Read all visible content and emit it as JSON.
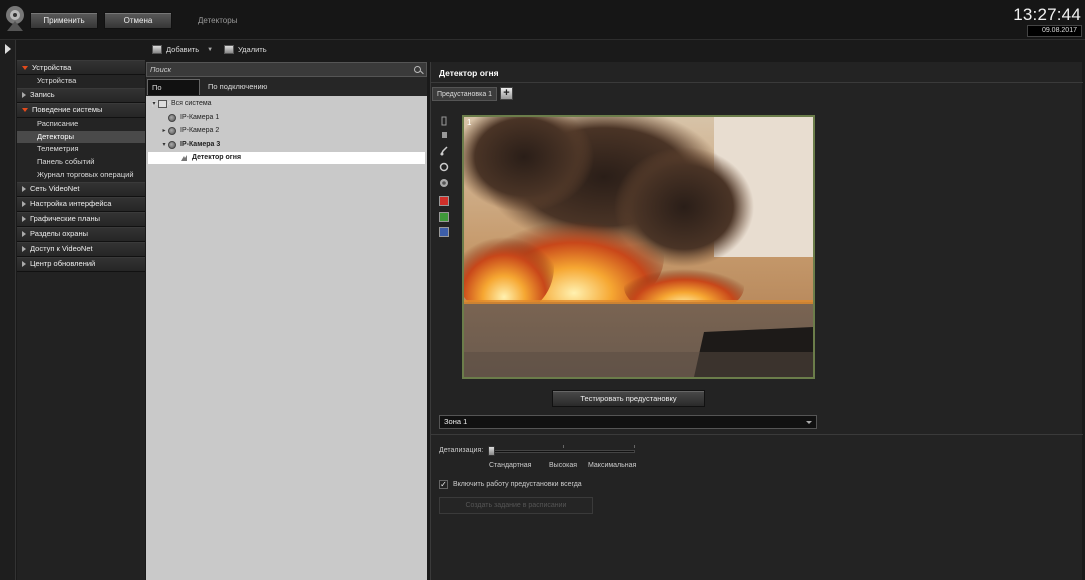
{
  "topbar": {
    "apply_label": "Применить",
    "cancel_label": "Отмена",
    "title": "Детекторы",
    "clock": "13:27:44",
    "date": "09.08.2017"
  },
  "toolbar": {
    "add_label": "Добавить",
    "delete_label": "Удалить"
  },
  "nav": {
    "sections": [
      {
        "label": "Устройства",
        "expanded": true,
        "items": [
          "Устройства"
        ]
      },
      {
        "label": "Запись",
        "expanded": false,
        "items": []
      },
      {
        "label": "Поведение системы",
        "expanded": true,
        "items": [
          "Расписание",
          "Детекторы",
          "Телеметрия",
          "Панель событий",
          "Журнал торговых операций"
        ]
      },
      {
        "label": "Сеть VideoNet",
        "expanded": false,
        "items": []
      },
      {
        "label": "Настройка интерфейса",
        "expanded": false,
        "items": []
      },
      {
        "label": "Графические планы",
        "expanded": false,
        "items": []
      },
      {
        "label": "Разделы охраны",
        "expanded": false,
        "items": []
      },
      {
        "label": "Доступ к VideoNet",
        "expanded": false,
        "items": []
      },
      {
        "label": "Центр обновлений",
        "expanded": false,
        "items": []
      }
    ],
    "selected_item": "Детекторы"
  },
  "tree": {
    "search_placeholder": "Поиск",
    "tabs": [
      "По разделам",
      "По подключению"
    ],
    "active_tab": "По разделам",
    "nodes": [
      {
        "label": "Вся система",
        "level": 0,
        "expander": "▾",
        "icon": "system-icon"
      },
      {
        "label": "IP-Камера 1",
        "level": 1,
        "expander": "",
        "icon": "camera-icon"
      },
      {
        "label": "IP-Камера 2",
        "level": 1,
        "expander": "▸",
        "icon": "camera-icon"
      },
      {
        "label": "IP-Камера 3",
        "level": 1,
        "expander": "▾",
        "icon": "camera-icon",
        "bold": true
      },
      {
        "label": "Детектор огня",
        "level": 2,
        "expander": "",
        "icon": "fire-detector-icon",
        "bold": true,
        "selected": true
      }
    ]
  },
  "detector": {
    "title": "Детектор огня",
    "preset_tab": "Предустановка 1",
    "preset_add": "+",
    "video_number": "1",
    "test_button": "Тестировать предустановку",
    "zone": "Зона 1",
    "detail_label": "Детализация:",
    "detail_levels": [
      "Стандартная",
      "Высокая",
      "Максимальная"
    ],
    "detail_value": "Стандартная",
    "checkbox_label": "Включить работу предустановки всегда",
    "checkbox_checked": true,
    "checkbox_mark": "✓",
    "schedule_button": "Создать задание в расписании",
    "tool_icons": [
      "pointer-icon",
      "rectangle-icon",
      "brush-icon",
      "eraser-icon",
      "fill-icon",
      "red-color-icon",
      "green-color-icon",
      "blue-color-icon"
    ],
    "colors": {
      "red": "#d0302a",
      "green": "#3f9a3a",
      "blue": "#3d5ea8",
      "video_border": "#6b7d4a"
    }
  }
}
